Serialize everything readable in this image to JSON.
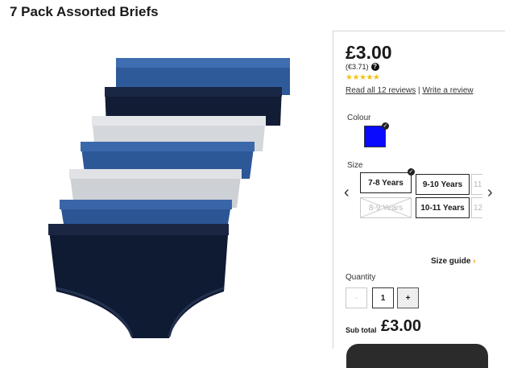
{
  "product": {
    "title": "7 Pack Assorted Briefs",
    "price": "£3.00",
    "euro_price": "(€3.71)",
    "rating_stars": 5,
    "reviews_link": "Read all 12 reviews",
    "write_review_link": "Write a review",
    "separator": "|"
  },
  "colour": {
    "label": "Colour",
    "selected_hex": "#0a0aff"
  },
  "size": {
    "label": "Size",
    "options_row1": [
      "7-8 Years",
      "9-10 Years",
      "11"
    ],
    "options_row2": [
      "8-9 Years",
      "10-11 Years",
      "12"
    ],
    "selected": "7-8 Years",
    "unavailable": [
      "8-9 Years"
    ],
    "size_guide": "Size guide"
  },
  "quantity": {
    "label": "Quantity",
    "decrement": "-",
    "value": "1",
    "increment": "+"
  },
  "subtotal": {
    "label": "Sub total",
    "value": "£3.00"
  },
  "colors": {
    "star": "#f4c20d",
    "size_guide_chevron": "#f0a500",
    "button_dark": "#2b2b2b"
  }
}
